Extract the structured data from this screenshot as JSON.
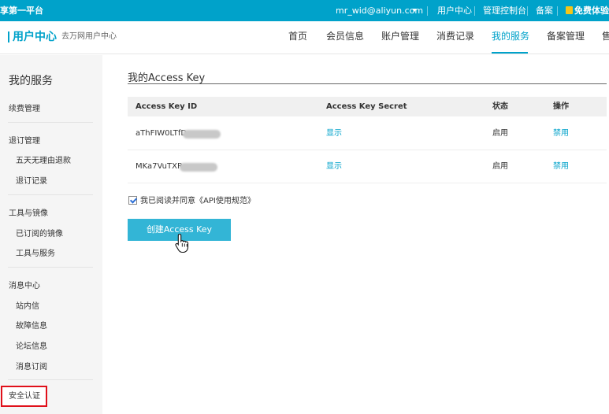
{
  "topbar": {
    "brand": "享第一平台",
    "account": "mr_wid@aliyun.com",
    "links": [
      "用户中心",
      "管理控制台",
      "备案",
      "免费体验"
    ]
  },
  "header": {
    "title": "用户中心",
    "subtitle": "去万网用户中心",
    "nav": [
      "首页",
      "会员信息",
      "账户管理",
      "消费记录",
      "我的服务",
      "备案管理",
      "售"
    ],
    "active_nav": "我的服务"
  },
  "sidebar": {
    "heading": "我的服务",
    "groups": [
      {
        "label": "续费管理",
        "items": []
      },
      {
        "label": "退订管理",
        "items": [
          "五天无理由退款",
          "退订记录"
        ]
      },
      {
        "label": "工具与镜像",
        "items": [
          "已订阅的镜像",
          "工具与服务"
        ]
      },
      {
        "label": "消息中心",
        "items": [
          "站内信",
          "故障信息",
          "论坛信息",
          "消息订阅"
        ]
      }
    ],
    "active_item": "安全认证"
  },
  "main": {
    "title": "我的Access Key",
    "columns": [
      "Access Key ID",
      "Access Key Secret",
      "状态",
      "操作"
    ],
    "rows": [
      {
        "id": "aThFIW0LTfD",
        "secret": "显示",
        "status": "启用",
        "action": "禁用"
      },
      {
        "id": "MKa7VuTXR",
        "secret": "显示",
        "status": "启用",
        "action": "禁用"
      }
    ],
    "agree_text": "我已阅读并同意《API使用规范》",
    "create_button": "创建Access Key"
  },
  "colors": {
    "accent": "#00a2ca",
    "button": "#33b5d6",
    "highlight_border": "#e0101a"
  }
}
